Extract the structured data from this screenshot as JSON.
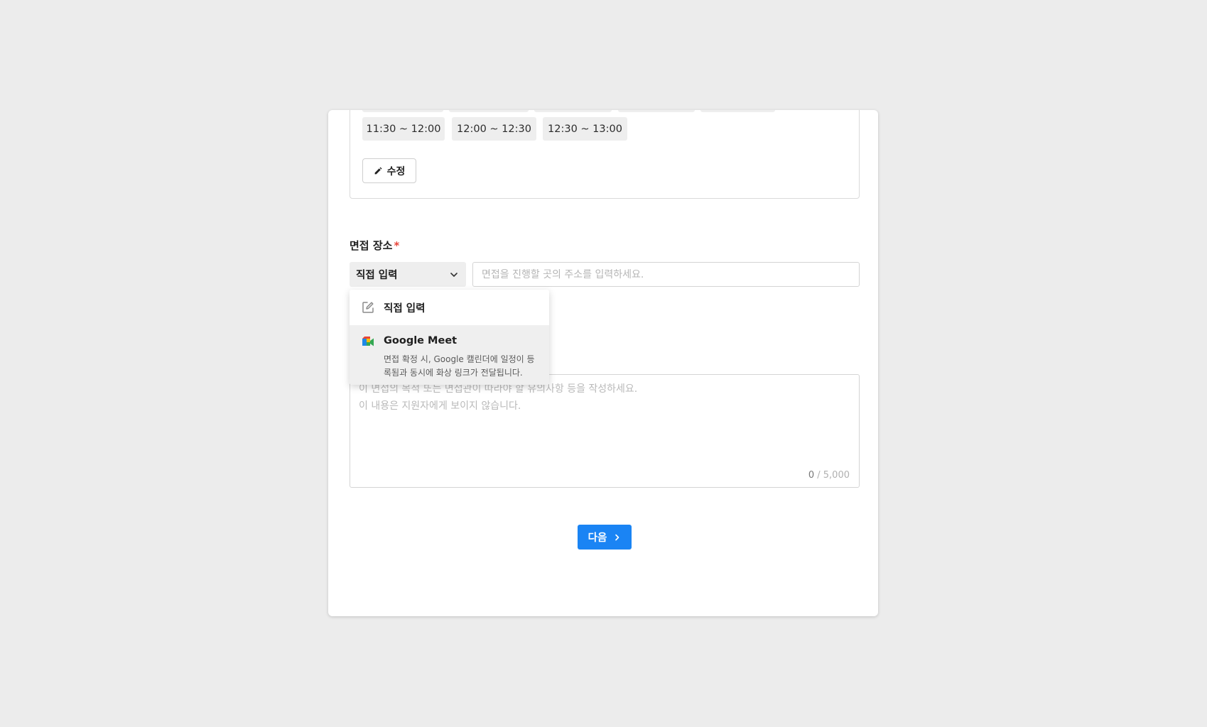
{
  "slots": {
    "row_visible": [
      "11:30 ~ 12:00",
      "12:00 ~ 12:30",
      "12:30 ~ 13:00"
    ],
    "edit_label": "수정"
  },
  "location": {
    "label": "면접 장소",
    "required_mark": "*",
    "select_value": "직접 입력",
    "address_placeholder": "면접을 진행할 곳의 주소를 입력하세요."
  },
  "menu": {
    "items": [
      {
        "title": "직접 입력",
        "icon": "edit-square-icon"
      },
      {
        "title": "Google Meet",
        "icon": "google-meet-icon",
        "description": "면접 확정 시, Google 캘린더에 일정이 등록됨과 동시에 화상 링크가 전달됩니다."
      }
    ]
  },
  "memo": {
    "placeholder_line1": "이 면접의 목적 또는 면접관이 따라야 할 유의사항 등을 작성하세요.",
    "placeholder_line2": "이 내용은 지원자에게 보이지 않습니다.",
    "count_current": "0",
    "count_max": " / 5,000"
  },
  "footer": {
    "next_label": "다음"
  },
  "colors": {
    "accent": "#1a84f4",
    "required": "#e8463b",
    "page_bg": "#ececec"
  }
}
